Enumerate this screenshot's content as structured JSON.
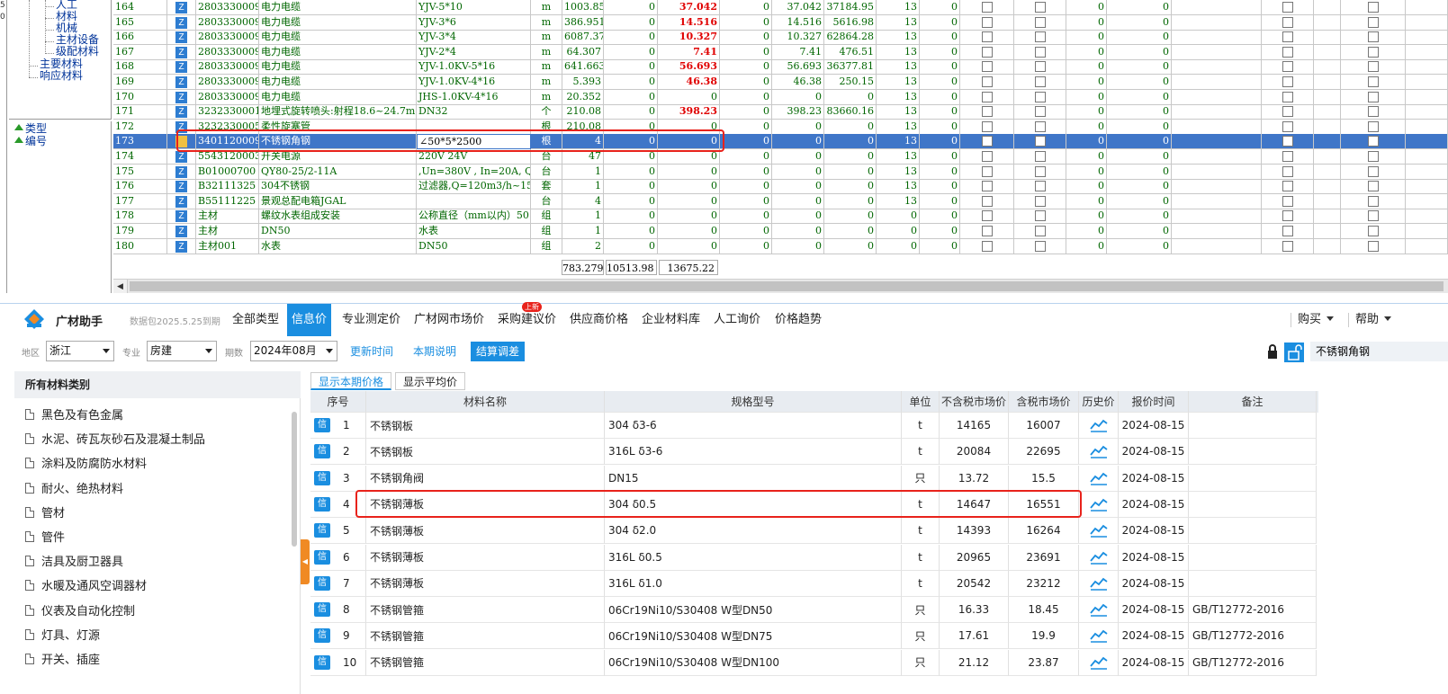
{
  "left_gutter": [
    "5",
    "0"
  ],
  "tree": {
    "items": [
      "人工",
      "材料",
      "机械",
      "主材设备",
      "级配材料",
      "主要材料",
      "响应材料"
    ]
  },
  "attributes": [
    "类型",
    "编号"
  ],
  "grid": {
    "rows": [
      {
        "no": "164",
        "z": "Z",
        "code": "2803330009",
        "name": "电力电缆",
        "spec": "YJV-5*10",
        "unit": "m",
        "qty": "1003.85",
        "c1": "0",
        "c2": "37.042",
        "c3": "0",
        "c4": "37.042",
        "c5": "37184.95",
        "c6": "13",
        "c7": "0",
        "c8": "0",
        "c9": "0"
      },
      {
        "no": "165",
        "z": "Z",
        "code": "2803330009",
        "name": "电力电缆",
        "spec": "YJV-3*6",
        "unit": "m",
        "qty": "386.951",
        "c1": "0",
        "c2": "14.516",
        "c3": "0",
        "c4": "14.516",
        "c5": "5616.98",
        "c6": "13",
        "c7": "0",
        "c8": "0",
        "c9": "0"
      },
      {
        "no": "166",
        "z": "Z",
        "code": "2803330009",
        "name": "电力电缆",
        "spec": "YJV-3*4",
        "unit": "m",
        "qty": "6087.37",
        "c1": "0",
        "c2": "10.327",
        "c3": "0",
        "c4": "10.327",
        "c5": "62864.28",
        "c6": "13",
        "c7": "0",
        "c8": "0",
        "c9": "0"
      },
      {
        "no": "167",
        "z": "Z",
        "code": "2803330009",
        "name": "电力电缆",
        "spec": "YJV-2*4",
        "unit": "m",
        "qty": "64.307",
        "c1": "0",
        "c2": "7.41",
        "c3": "0",
        "c4": "7.41",
        "c5": "476.51",
        "c6": "13",
        "c7": "0",
        "c8": "0",
        "c9": "0"
      },
      {
        "no": "168",
        "z": "Z",
        "code": "2803330009",
        "name": "电力电缆",
        "spec": "YJV-1.0KV-5*16",
        "unit": "m",
        "qty": "641.663",
        "c1": "0",
        "c2": "56.693",
        "c3": "0",
        "c4": "56.693",
        "c5": "36377.81",
        "c6": "13",
        "c7": "0",
        "c8": "0",
        "c9": "0"
      },
      {
        "no": "169",
        "z": "Z",
        "code": "2803330009",
        "name": "电力电缆",
        "spec": "YJV-1.0KV-4*16",
        "unit": "m",
        "qty": "5.393",
        "c1": "0",
        "c2": "46.38",
        "c3": "0",
        "c4": "46.38",
        "c5": "250.15",
        "c6": "13",
        "c7": "0",
        "c8": "0",
        "c9": "0"
      },
      {
        "no": "170",
        "z": "Z",
        "code": "2803330009",
        "name": "电力电缆",
        "spec": "JHS-1.0KV-4*16",
        "unit": "m",
        "qty": "20.352",
        "c1": "0",
        "c2": "0",
        "c3": "0",
        "c4": "0",
        "c5": "0",
        "c6": "13",
        "c7": "0",
        "c8": "0",
        "c9": "0"
      },
      {
        "no": "171",
        "z": "Z",
        "code": "3232330001",
        "name": "地埋式旋转喷头:射程18.6~24.7m,",
        "spec": "DN32",
        "unit": "个",
        "qty": "210.08",
        "c1": "0",
        "c2": "398.23",
        "c3": "0",
        "c4": "398.23",
        "c5": "83660.16",
        "c6": "13",
        "c7": "0",
        "c8": "0",
        "c9": "0"
      },
      {
        "no": "172",
        "z": "Z",
        "code": "3232330005",
        "name": "柔性旋塞管",
        "spec": "",
        "unit": "根",
        "qty": "210.08",
        "c1": "0",
        "c2": "0",
        "c3": "0",
        "c4": "0",
        "c5": "0",
        "c6": "13",
        "c7": "0",
        "c8": "0",
        "c9": "0"
      },
      {
        "no": "173",
        "z": "Z",
        "code": "3401120009",
        "name": "不锈钢角钢",
        "spec": "∠50*5*2500",
        "unit": "根",
        "qty": "4",
        "c1": "0",
        "c2": "0",
        "c3": "0",
        "c4": "0",
        "c5": "0",
        "c6": "13",
        "c7": "0",
        "c8": "0",
        "c9": "0"
      },
      {
        "no": "174",
        "z": "Z",
        "code": "5543120003",
        "name": "开关电源",
        "spec": "220V 24V",
        "unit": "台",
        "qty": "47",
        "c1": "0",
        "c2": "0",
        "c3": "0",
        "c4": "0",
        "c5": "0",
        "c6": "13",
        "c7": "0",
        "c8": "0",
        "c9": "0"
      },
      {
        "no": "175",
        "z": "Z",
        "code": "B01000700",
        "name": "QY80-25/2-11A",
        "spec": ",Un=380V , In=20A, Q=",
        "unit": "台",
        "qty": "1",
        "c1": "0",
        "c2": "0",
        "c3": "0",
        "c4": "0",
        "c5": "0",
        "c6": "13",
        "c7": "0",
        "c8": "0",
        "c9": "0"
      },
      {
        "no": "176",
        "z": "Z",
        "code": "B32111325",
        "name": "304不锈钢",
        "spec": "过滤器,Q=120m3/h~150m",
        "unit": "套",
        "qty": "1",
        "c1": "0",
        "c2": "0",
        "c3": "0",
        "c4": "0",
        "c5": "0",
        "c6": "13",
        "c7": "0",
        "c8": "0",
        "c9": "0"
      },
      {
        "no": "177",
        "z": "Z",
        "code": "B55111225",
        "name": "景观总配电箱JGAL",
        "spec": "",
        "unit": "台",
        "qty": "4",
        "c1": "0",
        "c2": "0",
        "c3": "0",
        "c4": "0",
        "c5": "0",
        "c6": "13",
        "c7": "0",
        "c8": "0",
        "c9": "0"
      },
      {
        "no": "178",
        "z": "Z",
        "code": "主材",
        "name": "螺纹水表组成安装",
        "spec": "公称直径（mm以内）50",
        "unit": "组",
        "qty": "1",
        "c1": "0",
        "c2": "0",
        "c3": "0",
        "c4": "0",
        "c5": "0",
        "c6": "0",
        "c7": "0",
        "c8": "0",
        "c9": "0"
      },
      {
        "no": "179",
        "z": "Z",
        "code": "主材",
        "name": "DN50",
        "spec": "水表",
        "unit": "组",
        "qty": "1",
        "c1": "0",
        "c2": "0",
        "c3": "0",
        "c4": "0",
        "c5": "0",
        "c6": "0",
        "c7": "0",
        "c8": "0",
        "c9": "0"
      },
      {
        "no": "180",
        "z": "Z",
        "code": "主材001",
        "name": "水表",
        "spec": "DN50",
        "unit": "组",
        "qty": "2",
        "c1": "0",
        "c2": "0",
        "c3": "0",
        "c4": "0",
        "c5": "0",
        "c6": "0",
        "c7": "0",
        "c8": "0",
        "c9": "0"
      }
    ],
    "selected_row": "173",
    "totals": [
      "783.279",
      "10513.98",
      "13675.22"
    ]
  },
  "nav": {
    "app_name": "广材助手",
    "package": "数据包2025.5.25到期",
    "tabs": [
      "全部类型",
      "信息价",
      "专业测定价",
      "广材网市场价",
      "采购建议价",
      "供应商价格",
      "企业材料库",
      "人工询价",
      "价格趋势"
    ],
    "active_tab": "信息价",
    "new_badge": "上新",
    "buy": "购买",
    "help": "帮助"
  },
  "filters": {
    "region_label": "地区",
    "region": "浙江",
    "major_label": "专业",
    "major": "房建",
    "period_label": "期数",
    "period": "2024年08月",
    "update_time": "更新时间",
    "period_desc": "本期说明",
    "settle": "结算调差",
    "search_value": "不锈钢角钢"
  },
  "categories": {
    "header": "所有材料类别",
    "items": [
      "黑色及有色金属",
      "水泥、砖瓦灰砂石及混凝土制品",
      "涂料及防腐防水材料",
      "耐火、绝热材料",
      "管材",
      "管件",
      "洁具及厨卫器具",
      "水暖及通风空调器材",
      "仪表及自动化控制",
      "灯具、灯源",
      "开关、插座"
    ]
  },
  "price_table": {
    "toggles": [
      "显示本期价格",
      "显示平均价"
    ],
    "headers": [
      "序号",
      "材料名称",
      "规格型号",
      "单位",
      "不含税市场价",
      "含税市场价",
      "历史价",
      "报价时间",
      "备注"
    ],
    "badge": "信",
    "rows": [
      {
        "no": "1",
        "name": "不锈钢板",
        "spec": "304 δ3-6",
        "unit": "t",
        "ex": "14165",
        "inc": "16007",
        "date": "2024-08-15",
        "note": ""
      },
      {
        "no": "2",
        "name": "不锈钢板",
        "spec": "316L δ3-6",
        "unit": "t",
        "ex": "20084",
        "inc": "22695",
        "date": "2024-08-15",
        "note": ""
      },
      {
        "no": "3",
        "name": "不锈钢角阀",
        "spec": "DN15",
        "unit": "只",
        "ex": "13.72",
        "inc": "15.5",
        "date": "2024-08-15",
        "note": ""
      },
      {
        "no": "4",
        "name": "不锈钢薄板",
        "spec": "304 δ0.5",
        "unit": "t",
        "ex": "14647",
        "inc": "16551",
        "date": "2024-08-15",
        "note": ""
      },
      {
        "no": "5",
        "name": "不锈钢薄板",
        "spec": "304 δ2.0",
        "unit": "t",
        "ex": "14393",
        "inc": "16264",
        "date": "2024-08-15",
        "note": ""
      },
      {
        "no": "6",
        "name": "不锈钢薄板",
        "spec": "316L δ0.5",
        "unit": "t",
        "ex": "20965",
        "inc": "23691",
        "date": "2024-08-15",
        "note": ""
      },
      {
        "no": "7",
        "name": "不锈钢薄板",
        "spec": "316L δ1.0",
        "unit": "t",
        "ex": "20542",
        "inc": "23212",
        "date": "2024-08-15",
        "note": ""
      },
      {
        "no": "8",
        "name": "不锈钢管箍",
        "spec": "06Cr19Ni10/S30408 W型DN50",
        "unit": "只",
        "ex": "16.33",
        "inc": "18.45",
        "date": "2024-08-15",
        "note": "GB/T12772-2016"
      },
      {
        "no": "9",
        "name": "不锈钢管箍",
        "spec": "06Cr19Ni10/S30408 W型DN75",
        "unit": "只",
        "ex": "17.61",
        "inc": "19.9",
        "date": "2024-08-15",
        "note": "GB/T12772-2016"
      },
      {
        "no": "10",
        "name": "不锈钢管箍",
        "spec": "06Cr19Ni10/S30408 W型DN100",
        "unit": "只",
        "ex": "21.12",
        "inc": "23.87",
        "date": "2024-08-15",
        "note": "GB/T12772-2016"
      }
    ]
  },
  "colors": {
    "accent": "#1a8ee0",
    "highlight": "#e8221b",
    "selected_row": "#3f76c8",
    "grid_text": "#006600"
  }
}
